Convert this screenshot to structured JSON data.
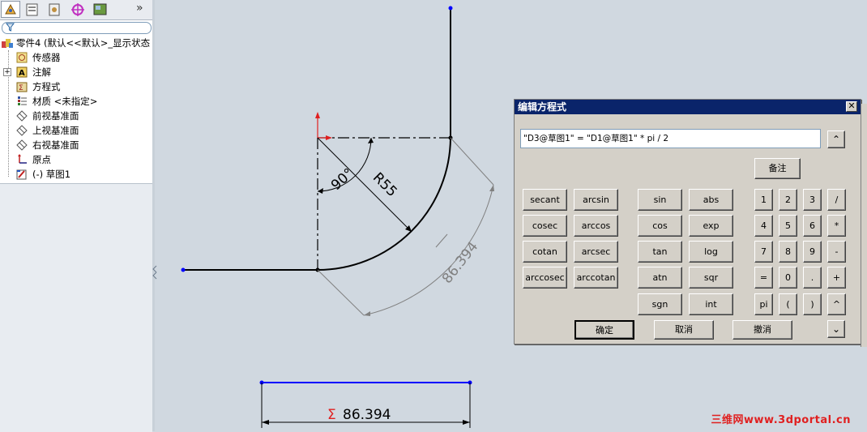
{
  "tree": {
    "root_label": "零件4 (默认<<默认>_显示状态",
    "items": [
      {
        "label": "传感器",
        "icon": "sensor-icon"
      },
      {
        "label": "注解",
        "icon": "annotation-icon"
      },
      {
        "label": "方程式",
        "icon": "equation-icon"
      },
      {
        "label": "材质 <未指定>",
        "icon": "material-icon"
      },
      {
        "label": "前视基准面",
        "icon": "plane-icon"
      },
      {
        "label": "上视基准面",
        "icon": "plane-icon"
      },
      {
        "label": "右视基准面",
        "icon": "plane-icon"
      },
      {
        "label": "原点",
        "icon": "origin-icon"
      },
      {
        "label": "(-) 草图1",
        "icon": "sketch-icon"
      }
    ],
    "expander": "+"
  },
  "toolbar": {
    "overflow": "»"
  },
  "sketch": {
    "angle_dim": "90°",
    "radius_dim": "R55",
    "arc_length_dim": "86.394",
    "sum_symbol": "Σ",
    "sum_value": "86.394",
    "line_color": "#000000",
    "dim_color": "#808080",
    "driven_color": "#0000ff",
    "origin_color": "#e02020"
  },
  "dialog": {
    "title": "编辑方程式",
    "close": "✕",
    "expression": "\"D3@草图1\" = \"D1@草图1\" * pi / 2",
    "comment_button": "备注",
    "functions": [
      [
        "secant",
        "arcsin",
        "sin",
        "abs"
      ],
      [
        "cosec",
        "arccos",
        "cos",
        "exp"
      ],
      [
        "cotan",
        "arcsec",
        "tan",
        "log"
      ],
      [
        "arccosec",
        "arccotan",
        "atn",
        "sqr"
      ],
      [
        "",
        "",
        "sgn",
        "int"
      ]
    ],
    "keypad": [
      [
        "1",
        "2",
        "3",
        "/"
      ],
      [
        "4",
        "5",
        "6",
        "*"
      ],
      [
        "7",
        "8",
        "9",
        "-"
      ],
      [
        "=",
        "0",
        ".",
        "+"
      ],
      [
        "pi",
        "(",
        ")",
        "^"
      ]
    ],
    "ok": "确定",
    "cancel": "取消",
    "undo": "撤消",
    "up": "⌃",
    "down": "⌄"
  },
  "watermark": "三维网www.3dportal.cn"
}
